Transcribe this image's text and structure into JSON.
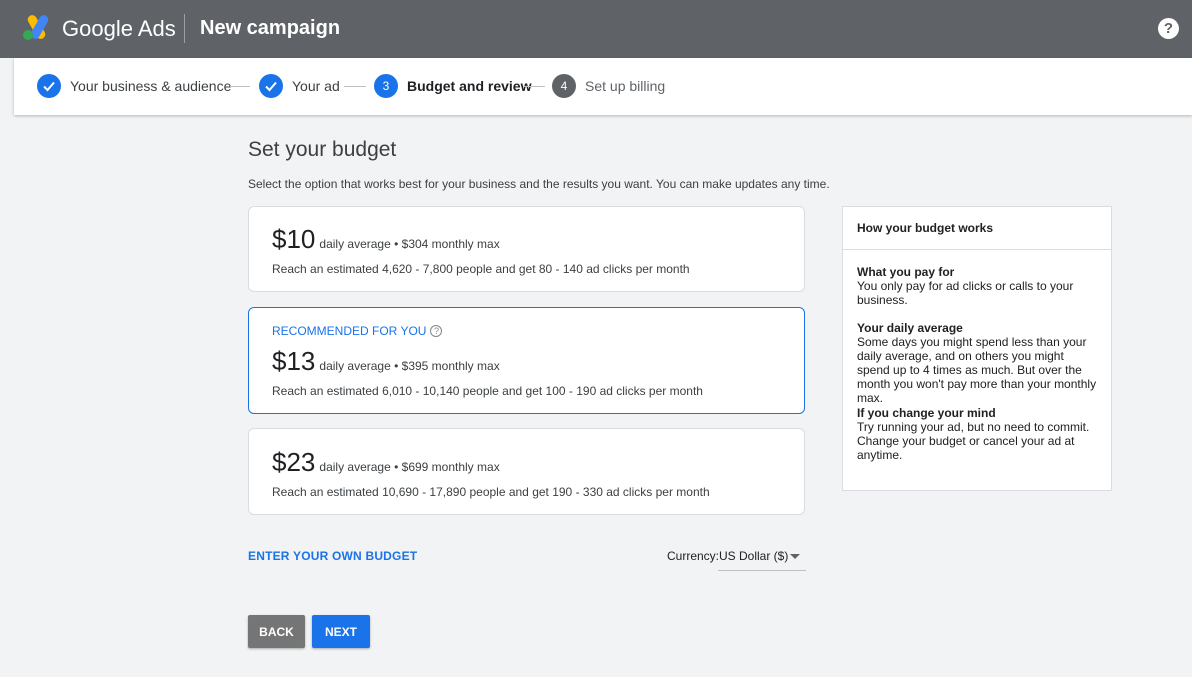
{
  "header": {
    "brand": "Google Ads",
    "title": "New campaign",
    "help_icon": "help-icon",
    "help_label": "?"
  },
  "stepper": {
    "steps": [
      {
        "label": "Your business & audience",
        "status": "done"
      },
      {
        "label": "Your ad",
        "status": "done"
      },
      {
        "label": "Budget and review",
        "status": "active",
        "number": "3"
      },
      {
        "label": "Set up billing",
        "status": "todo",
        "number": "4"
      }
    ]
  },
  "main": {
    "title": "Set your budget",
    "subtitle": "Select the option that works best for your business and the results you want. You can make updates any time.",
    "options": [
      {
        "amount": "$10",
        "info": "daily average • $304 monthly max",
        "reach": "Reach an estimated 4,620 - 7,800 people and get 80 - 140 ad clicks per month"
      },
      {
        "recommended_label": "RECOMMENDED FOR YOU",
        "amount": "$13",
        "info": "daily average • $395 monthly max",
        "reach": "Reach an estimated 6,010 - 10,140 people and get 100 - 190 ad clicks per month"
      },
      {
        "amount": "$23",
        "info": "daily average • $699 monthly max",
        "reach": "Reach an estimated 10,690 - 17,890 people and get 190 - 330 ad clicks per month"
      }
    ],
    "own_budget_link": "ENTER YOUR OWN BUDGET",
    "currency": {
      "label": "Currency:",
      "value": "US Dollar ($)"
    },
    "back_label": "BACK",
    "next_label": "NEXT"
  },
  "sidebar": {
    "title": "How your budget works",
    "sections": [
      {
        "heading": "What you pay for",
        "body": "You only pay for ad clicks or calls to your business."
      },
      {
        "heading": "Your daily average",
        "body": "Some days you might spend less than your daily average, and on others you might spend up to 4 times as much. But over the month you won't pay more than your monthly max."
      },
      {
        "heading": "If you change your mind",
        "body": "Try running your ad, but no need to commit. Change your budget or cancel your ad at anytime."
      }
    ]
  },
  "colors": {
    "accent": "#1a73e8",
    "topbar": "#5f6368",
    "back_button": "#757575"
  }
}
